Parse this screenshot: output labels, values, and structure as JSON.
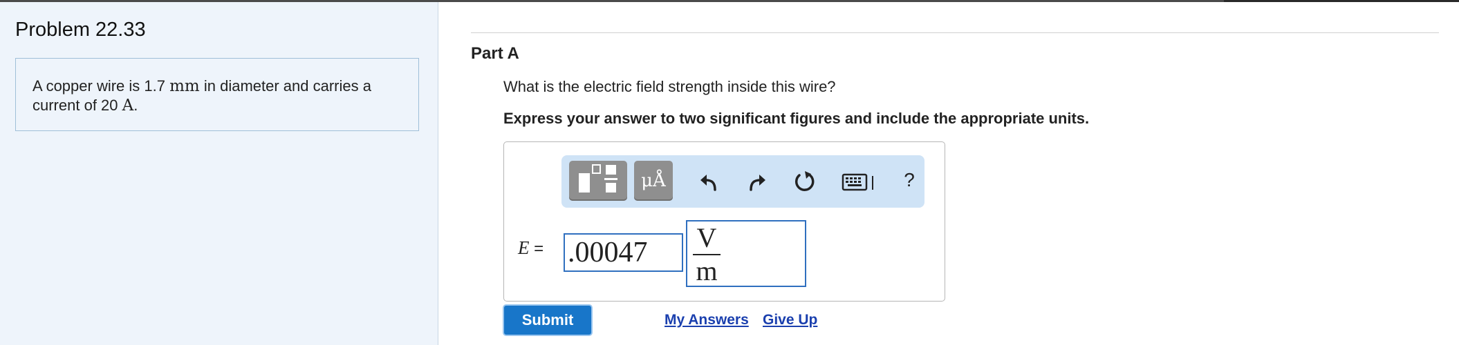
{
  "problem": {
    "title": "Problem 22.33",
    "text_before_diameter": "A copper wire is 1.7 ",
    "diameter_unit": "mm",
    "text_between": " in diameter and carries a current of 20 ",
    "current_unit": "A",
    "text_end": "."
  },
  "part": {
    "title": "Part A",
    "question": "What is the electric field strength inside this wire?",
    "instruction": "Express your answer to two significant figures and include the appropriate units."
  },
  "toolbar": {
    "units_label": "μÅ",
    "help_label": "?",
    "icons": [
      "templates-icon",
      "units-icon",
      "undo-icon",
      "redo-icon",
      "reset-icon",
      "keyboard-icon",
      "help-icon"
    ]
  },
  "answer": {
    "variable": "E",
    "equals": " =",
    "value": ".00047",
    "unit_numerator": "V",
    "unit_denominator": "m"
  },
  "actions": {
    "submit_label": "Submit",
    "my_answers_label": "My Answers",
    "give_up_label": "Give Up"
  },
  "colors": {
    "accent": "#1876c9",
    "link": "#1a3fae",
    "left_panel_bg": "#eef4fb",
    "toolbar_bg": "#cfe3f6",
    "input_border": "#2f6fbf"
  }
}
